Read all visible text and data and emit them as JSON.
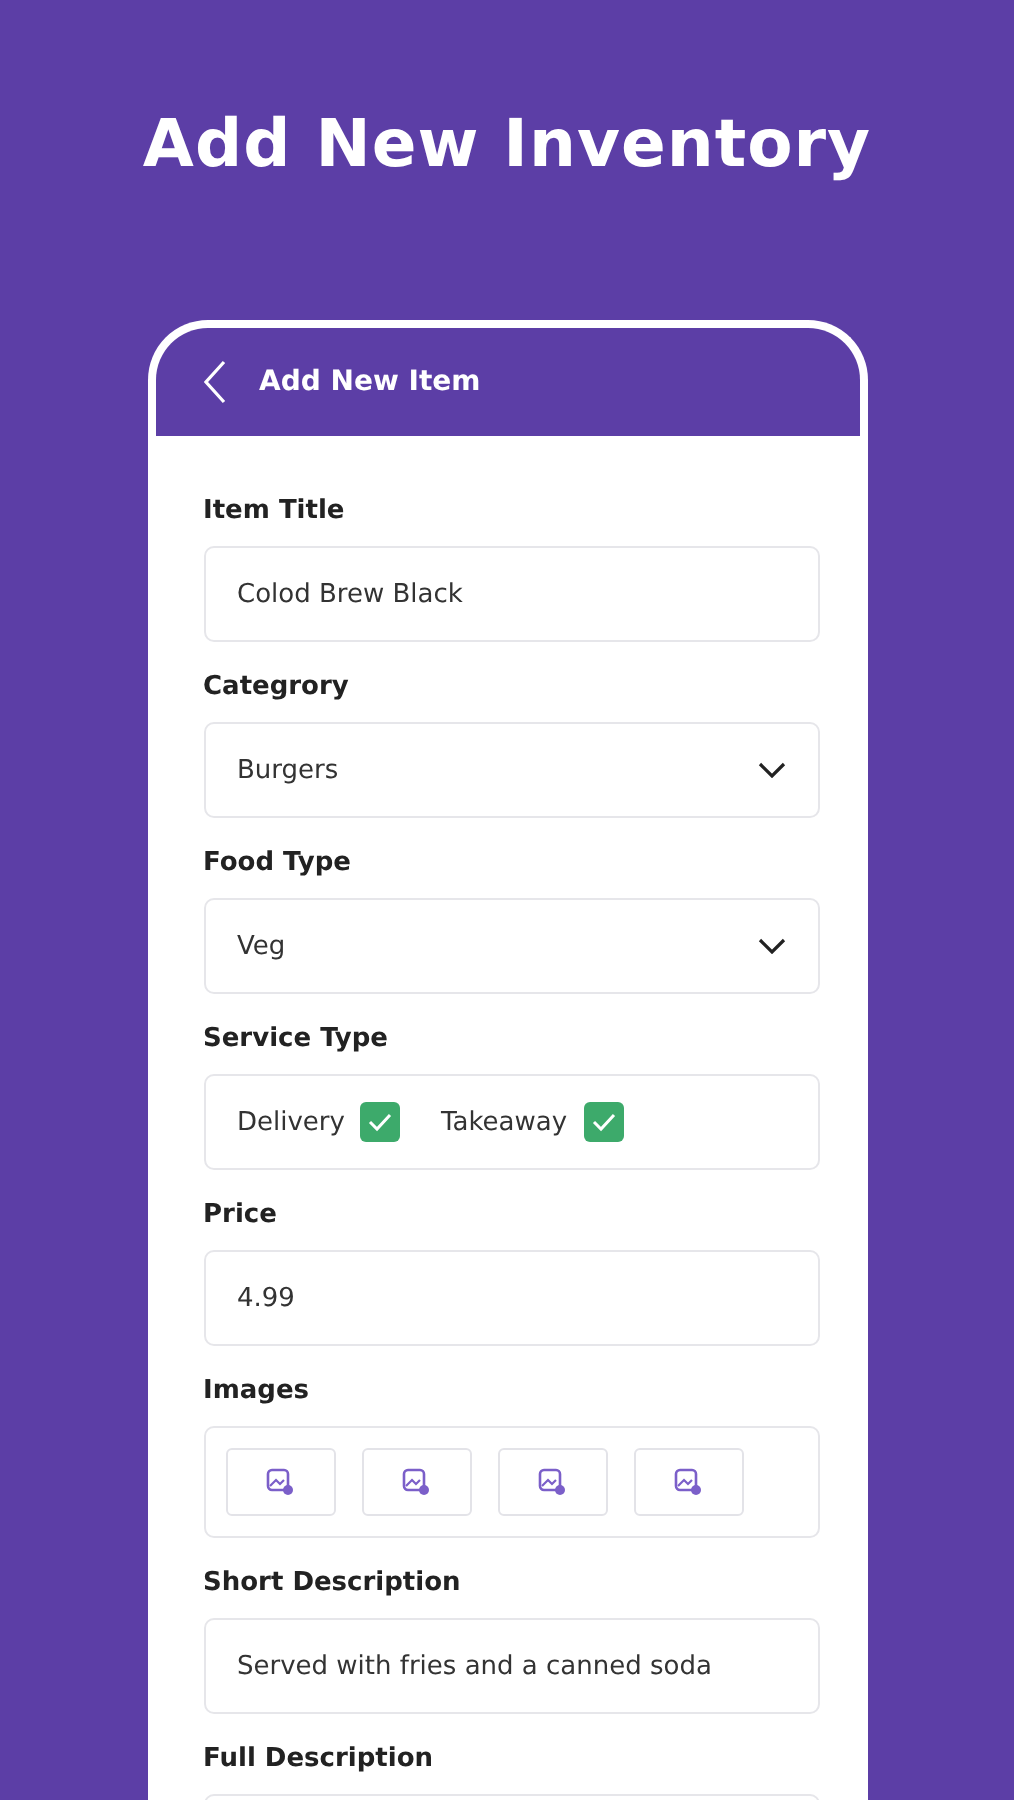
{
  "headline": "Add New Inventory",
  "header": {
    "title": "Add New Item"
  },
  "fields": [
    {
      "kind": "text",
      "label": "Item Title",
      "value": "Colod Brew Black"
    },
    {
      "kind": "select",
      "label": "Categrory",
      "value": "Burgers"
    },
    {
      "kind": "select",
      "label": "Food Type",
      "value": "Veg"
    },
    {
      "kind": "checks",
      "label": "Service Type",
      "options": [
        {
          "label": "Delivery",
          "checked": true
        },
        {
          "label": "Takeaway",
          "checked": true
        }
      ]
    },
    {
      "kind": "text",
      "label": "Price",
      "value": "4.99"
    },
    {
      "kind": "images",
      "label": "Images",
      "slots": [
        {
          "kind": "image"
        },
        {
          "kind": "image"
        },
        {
          "kind": "image"
        },
        {
          "kind": "image"
        }
      ]
    },
    {
      "kind": "text",
      "label": "Short Description",
      "value": "Served with fries and a canned soda"
    },
    {
      "kind": "text",
      "label": "Full Description"
    }
  ]
}
